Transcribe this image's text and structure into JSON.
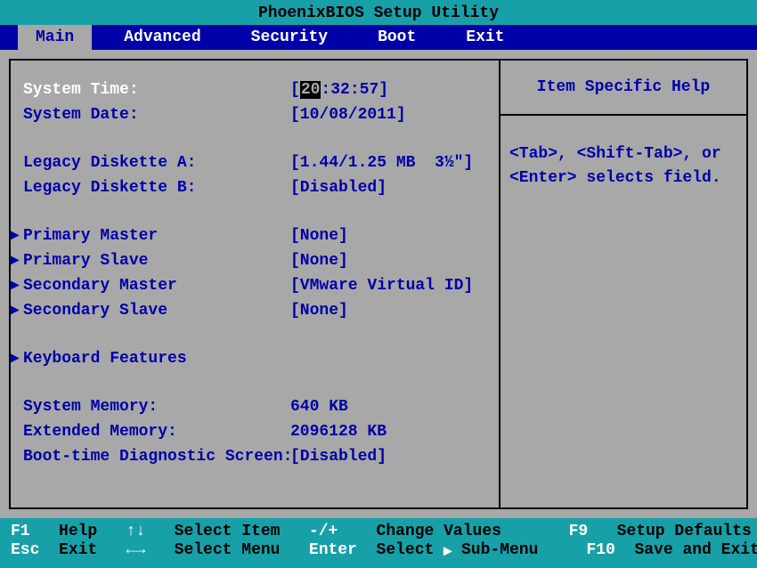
{
  "title": "PhoenixBIOS Setup Utility",
  "menu": {
    "items": [
      "Main",
      "Advanced",
      "Security",
      "Boot",
      "Exit"
    ],
    "active_index": 0
  },
  "main": {
    "system_time": {
      "label": "System Time:",
      "hh": "20",
      "mm": "32",
      "ss": "57"
    },
    "system_date": {
      "label": "System Date:",
      "value": "[10/08/2011]"
    },
    "diskette_a": {
      "label": "Legacy Diskette A:",
      "value": "[1.44/1.25 MB  3½\"]"
    },
    "diskette_b": {
      "label": "Legacy Diskette B:",
      "value": "[Disabled]"
    },
    "primary_master": {
      "label": "Primary Master",
      "value": "[None]"
    },
    "primary_slave": {
      "label": "Primary Slave",
      "value": "[None]"
    },
    "secondary_master": {
      "label": "Secondary Master",
      "value": "[VMware Virtual ID]"
    },
    "secondary_slave": {
      "label": "Secondary Slave",
      "value": "[None]"
    },
    "keyboard_features": {
      "label": "Keyboard Features"
    },
    "system_memory": {
      "label": "System Memory:",
      "value": "640 KB"
    },
    "extended_memory": {
      "label": "Extended Memory:",
      "value": "2096128 KB"
    },
    "boot_diag": {
      "label": "Boot-time Diagnostic Screen:",
      "value": "[Disabled]"
    }
  },
  "help": {
    "title": "Item Specific Help",
    "body": "<Tab>, <Shift-Tab>, or <Enter> selects field."
  },
  "footer": {
    "f1": "F1",
    "help": "Help",
    "updown": "↑↓",
    "select_item": "Select Item",
    "plusminus": "-/+",
    "change_values": "Change Values",
    "f9": "F9",
    "setup_defaults": "Setup Defaults",
    "esc": "Esc",
    "exit": "Exit",
    "leftright": "←→",
    "select_menu": "Select Menu",
    "enter": "Enter",
    "select": "Select",
    "submenu": "Sub-Menu",
    "f10": "F10",
    "save_exit": "Save and Exit"
  }
}
